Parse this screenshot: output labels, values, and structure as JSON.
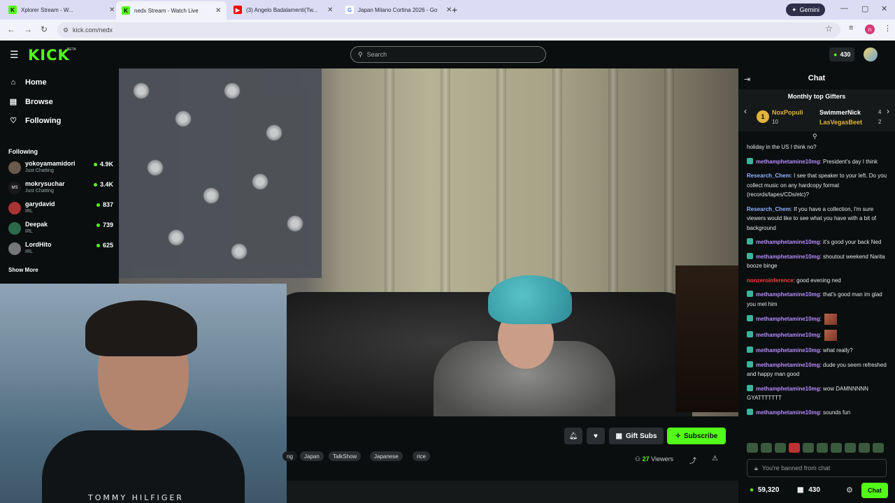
{
  "browser": {
    "tabs": [
      {
        "title": "Xplorer Stream - W...",
        "favicon": "K",
        "color": "#53fc18"
      },
      {
        "title": "nedx Stream - Watch Live",
        "favicon": "K",
        "color": "#53fc18"
      },
      {
        "title": "(3) Angelo Badalamenti(Tw...",
        "favicon": "▶",
        "color": "#ff0000"
      },
      {
        "title": "Japan Milano Cortina 2026 - Go",
        "favicon": "G",
        "color": "#4285f4"
      }
    ],
    "gemini_label": "Gemini",
    "url": "kick.com/nedx",
    "profile_initial": "n"
  },
  "header": {
    "logo": "KICK",
    "logo_badge": "BETA",
    "search_placeholder": "Search",
    "kicks_balance": "430"
  },
  "sidebar": {
    "nav": [
      {
        "label": "Home",
        "icon": "home-icon"
      },
      {
        "label": "Browse",
        "icon": "browse-icon"
      },
      {
        "label": "Following",
        "icon": "heart-icon"
      }
    ],
    "following_heading": "Following",
    "channels": [
      {
        "name": "yokoyamamidori",
        "category": "Just Chatting",
        "viewers": "4.9K"
      },
      {
        "name": "mokrysuchar",
        "category": "Just Chatting",
        "viewers": "3.4K"
      },
      {
        "name": "garydavid",
        "category": "IRL",
        "viewers": "837"
      },
      {
        "name": "Deepak",
        "category": "IRL",
        "viewers": "739"
      },
      {
        "name": "LordHito",
        "category": "IRL",
        "viewers": "625"
      }
    ],
    "show_more": "Show More"
  },
  "webcam": {
    "shirt_text": "TOMMY HILFIGER"
  },
  "stream": {
    "gift_label": "Gift Subs",
    "subscribe_label": "Subscribe",
    "tag_fragment": "ng",
    "tags": [
      "Japan",
      "TalkShow",
      "Japanese",
      "rice"
    ],
    "viewer_count": "27",
    "viewers_label": "Viewers"
  },
  "chat": {
    "title": "Chat",
    "gifters_title": "Monthly top Gifters",
    "gifters": [
      {
        "name": "NoxPopuli",
        "count": "10",
        "color": "#e0b43c"
      },
      {
        "name": "SwimmerNick",
        "count": "4",
        "color": "#ffffff"
      },
      {
        "name": "LasVegasBeet",
        "count": "2",
        "color": "#e0b43c"
      }
    ],
    "messages": [
      {
        "user": "",
        "color": "#ffffff",
        "text": "holiday in the US I think no?",
        "badge": false
      },
      {
        "user": "methamphetamine10mg",
        "color": "#b78cff",
        "text": ": President's day I think",
        "badge": true
      },
      {
        "user": "Research_Chem",
        "color": "#8fb4ff",
        "text": ": I see that speaker to your left. Do you collect music on any hardcopy format (records/tapes/CDs/etc)?",
        "badge": false
      },
      {
        "user": "Research_Chem",
        "color": "#8fb4ff",
        "text": ": If you have a collection, I'm sure viewers would like to see what you have with a bit of background",
        "badge": false
      },
      {
        "user": "methamphetamine10mg",
        "color": "#b78cff",
        "text": ": it's good your back Ned",
        "badge": true
      },
      {
        "user": "methamphetamine10mg",
        "color": "#b78cff",
        "text": ": shoutout weekend Narita booze binge",
        "badge": true
      },
      {
        "user": "nonzeroinference",
        "color": "#ff3b3b",
        "text": ": good evening ned",
        "badge": false
      },
      {
        "user": "methamphetamine10mg",
        "color": "#b78cff",
        "text": ": that's good man im glad you met him",
        "badge": true
      },
      {
        "user": "methamphetamine10mg",
        "color": "#b78cff",
        "text": ":",
        "badge": true,
        "emote": true
      },
      {
        "user": "methamphetamine10mg",
        "color": "#b78cff",
        "text": ":",
        "badge": true,
        "emote": true
      },
      {
        "user": "methamphetamine10mg",
        "color": "#b78cff",
        "text": ": what really?",
        "badge": true
      },
      {
        "user": "methamphetamine10mg",
        "color": "#b78cff",
        "text": ": dude you seem refreshed and happy man good",
        "badge": true
      },
      {
        "user": "methamphetamine10mg",
        "color": "#b78cff",
        "text": ": wow DAMNNNNN GYATTTTTTT",
        "badge": true
      },
      {
        "user": "methamphetamine10mg",
        "color": "#b78cff",
        "text": ": sounds fun",
        "badge": true
      }
    ],
    "banned_text": "You're banned from chat",
    "kicks": "59,320",
    "gifts": "430",
    "chat_button": "Chat"
  },
  "colors": {
    "accent": "#53fc18",
    "background": "#0b0e0f"
  }
}
